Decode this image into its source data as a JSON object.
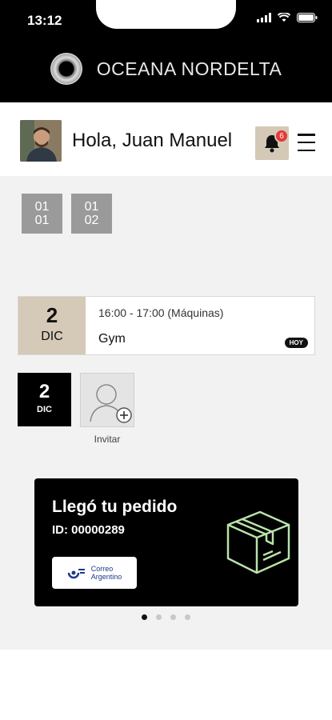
{
  "status_bar": {
    "time": "13:12"
  },
  "brand": {
    "name": "OCEANA NORDELTA"
  },
  "header": {
    "greeting": "Hola, Juan Manuel",
    "notifications_count": "6"
  },
  "units": [
    {
      "line1": "01",
      "line2": "01"
    },
    {
      "line1": "01",
      "line2": "02"
    }
  ],
  "event": {
    "day": "2",
    "month": "DIC",
    "time": "16:00 - 17:00 (Máquinas)",
    "name": "Gym",
    "badge": "HOY"
  },
  "date_box": {
    "day": "2",
    "month": "DIC"
  },
  "invite": {
    "label": "Invitar"
  },
  "promo": {
    "title": "Llegó tu pedido",
    "id": "ID: 00000289",
    "courier_line1": "Correo",
    "courier_line2": "Argentino"
  },
  "carousel": {
    "total": 4,
    "active": 1
  },
  "colors": {
    "accent_beige": "#d5c9b8",
    "badge_red": "#e53935",
    "box_icon_green": "#b9e3a8"
  }
}
